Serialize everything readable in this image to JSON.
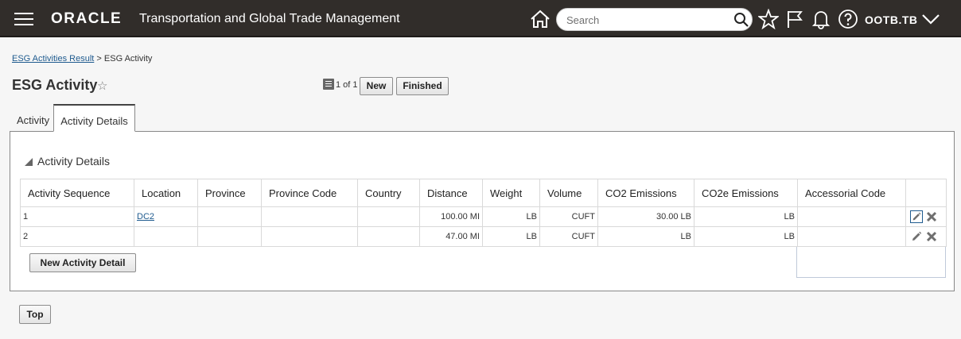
{
  "header": {
    "brand": "ORACLE",
    "app_title": "Transportation and Global Trade Management",
    "search_placeholder": "Search",
    "user": "OOTB.TB"
  },
  "breadcrumb": {
    "parent": "ESG Activities Result",
    "separator": ">",
    "current": "ESG Activity"
  },
  "page": {
    "title": "ESG Activity",
    "record_count": "1 of 1",
    "new_label": "New",
    "finished_label": "Finished"
  },
  "tabs": [
    {
      "label": "Activity",
      "active": false
    },
    {
      "label": "Activity Details",
      "active": true
    }
  ],
  "section": {
    "title": "Activity Details",
    "columns": [
      "Activity Sequence",
      "Location",
      "Province",
      "Province Code",
      "Country",
      "Distance",
      "Weight",
      "Volume",
      "CO2 Emissions",
      "CO2e Emissions",
      "Accessorial Code"
    ],
    "rows": [
      {
        "seq": "1",
        "location": "DC2",
        "province": "",
        "province_code": "",
        "country": "",
        "distance": "100.00 MI",
        "weight": "LB",
        "volume": "CUFT",
        "co2": "30.00 LB",
        "co2e": "LB",
        "accessorial": ""
      },
      {
        "seq": "2",
        "location": "",
        "province": "",
        "province_code": "",
        "country": "",
        "distance": "47.00 MI",
        "weight": "LB",
        "volume": "CUFT",
        "co2": "LB",
        "co2e": "LB",
        "accessorial": ""
      }
    ],
    "new_detail_label": "New Activity Detail"
  },
  "footer": {
    "top_label": "Top"
  },
  "colors": {
    "header_bg": "#312d2a",
    "link": "#1f5b8f"
  }
}
